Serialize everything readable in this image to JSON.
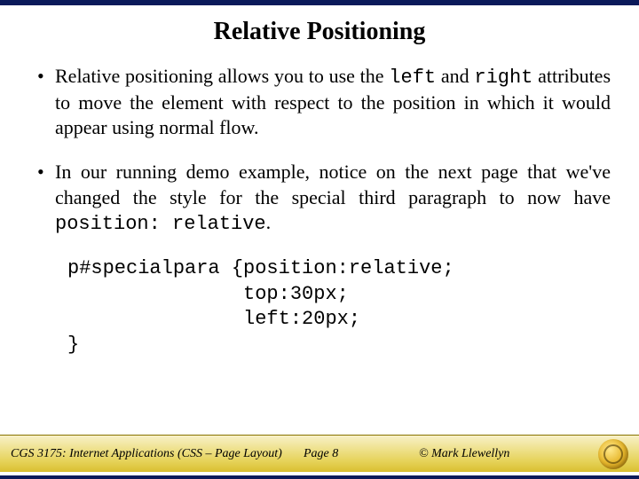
{
  "title": "Relative Positioning",
  "bullets": {
    "b1": {
      "pre": "Relative positioning allows you to use the ",
      "code1": "left",
      "mid": " and ",
      "code2": "right",
      "post": " attributes to move the element with respect to the position in which it would appear using normal flow."
    },
    "b2": {
      "pre": "In our running demo example, notice on the next page that we've changed the style for the special third paragraph to now have ",
      "code1": "position: relative",
      "post": "."
    }
  },
  "code": "p#specialpara {position:relative;\n               top:30px;\n               left:20px;\n}",
  "footer": {
    "course": "CGS 3175: Internet Applications (CSS – Page Layout)",
    "page": "Page 8",
    "copyright": "© Mark Llewellyn"
  }
}
